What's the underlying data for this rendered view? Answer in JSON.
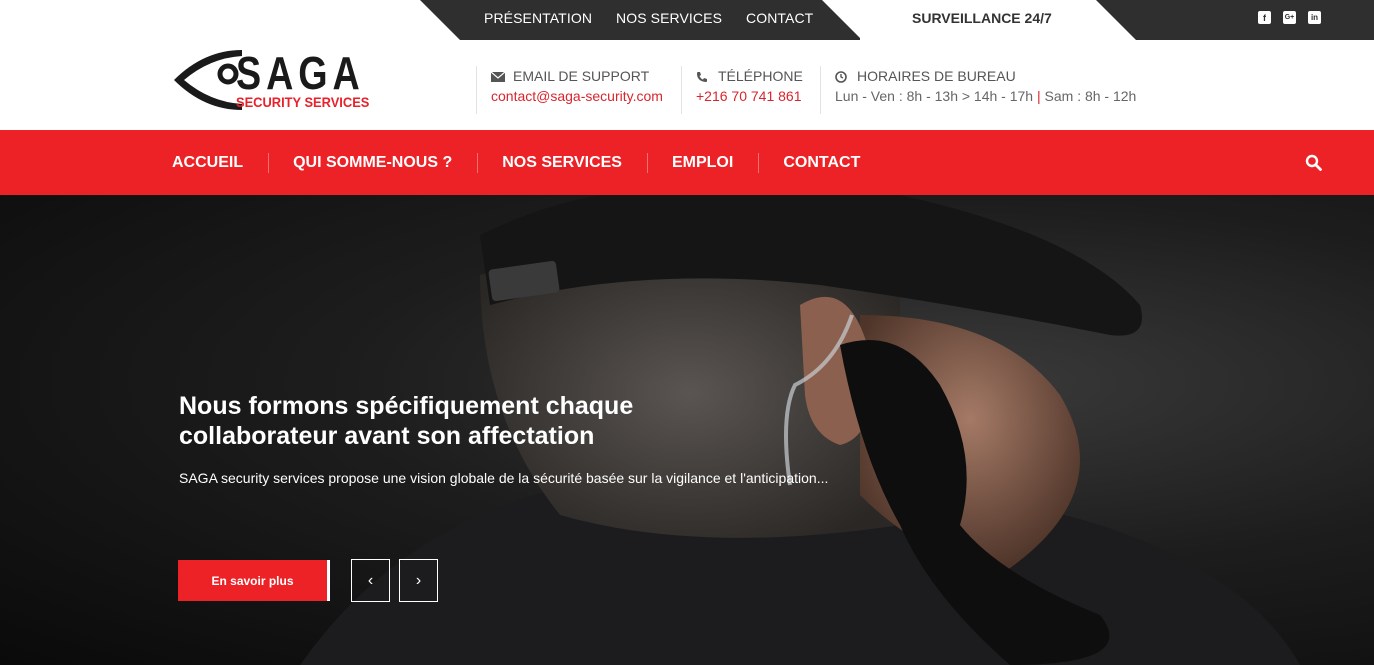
{
  "topbar": {
    "nav": [
      "PRÉSENTATION",
      "NOS SERVICES",
      "CONTACT"
    ],
    "surveillance": "SURVEILLANCE 24/7",
    "social": [
      {
        "icon": "facebook-icon",
        "glyph": "f"
      },
      {
        "icon": "google-plus-icon",
        "glyph": "G+"
      },
      {
        "icon": "linkedin-icon",
        "glyph": "in"
      }
    ]
  },
  "logo": {
    "name": "SAGA",
    "tagline": "SECURITY SERVICES"
  },
  "contact": {
    "email_label": "EMAIL DE SUPPORT",
    "email": "contact@saga-security.com",
    "phone_label": "TÉLÉPHONE",
    "phone": "+216 70 741 861",
    "hours_label": "HORAIRES DE BUREAU",
    "hours_weekday": "Lun - Ven : 8h - 13h > 14h - 17h",
    "hours_separator": "|",
    "hours_saturday": "Sam : 8h - 12h"
  },
  "mainnav": {
    "items": [
      "ACCUEIL",
      "QUI SOMME-NOUS ?",
      "NOS SERVICES",
      "EMPLOI",
      "CONTACT"
    ]
  },
  "hero": {
    "title_line1": "Nous formons spécifiquement chaque",
    "title_line2": "collaborateur avant son affectation",
    "text": "SAGA security services propose une vision globale de la sécurité basée sur la vigilance et l'anticipation...",
    "cta": "En savoir plus",
    "prev": "‹",
    "next": "›"
  },
  "colors": {
    "accent": "#ec2227",
    "dark": "#2f2f2f"
  }
}
